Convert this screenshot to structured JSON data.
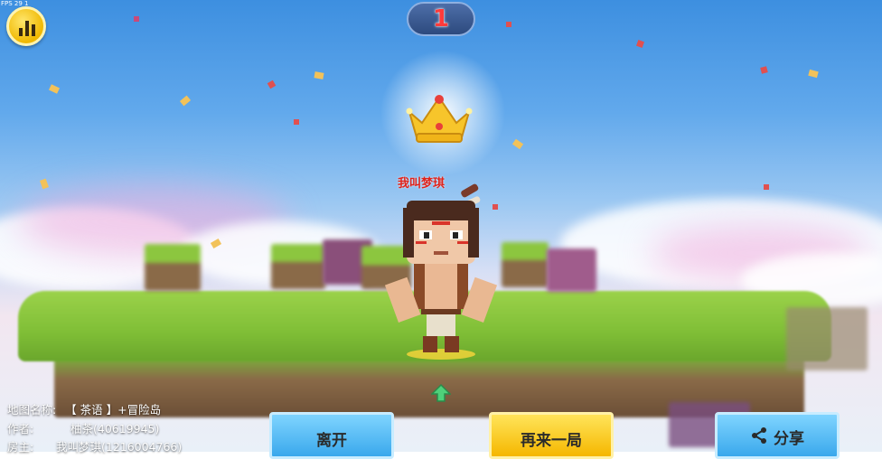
{
  "hud": {
    "fps_text": "FPS 29 1",
    "rank_number": "1",
    "stats_icon": "bar-chart-icon"
  },
  "result": {
    "crown_icon": "crown-icon",
    "player_name": "我叫梦琪"
  },
  "map_info": {
    "map_name_label": "地图名称:",
    "map_name_value": "【 茶语 】+冒险岛",
    "author_label": "作者:",
    "author_value": "柚茶(40619945)",
    "owner_label": "房主:",
    "owner_value": "我叫梦琪(1216004766)"
  },
  "buttons": {
    "leave_label": "离开",
    "replay_label": "再来一局",
    "share_label": "分享",
    "share_icon": "share-icon"
  },
  "colors": {
    "rank_red": "#ff3b3b",
    "name_red": "#e0241c",
    "button_blue": "#3aa8ec",
    "button_yellow": "#f5b700"
  }
}
